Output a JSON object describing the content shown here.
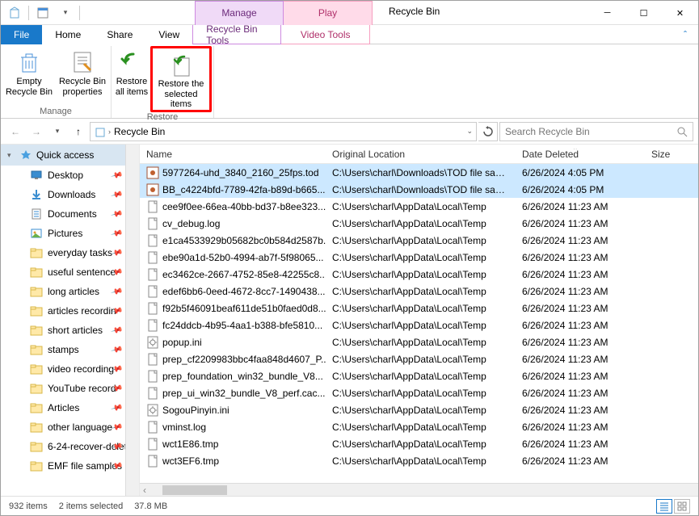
{
  "title": "Recycle Bin",
  "context_tabs": {
    "manage": "Manage",
    "play": "Play"
  },
  "tabs": {
    "file": "File",
    "home": "Home",
    "share": "Share",
    "view": "View",
    "rbt": "Recycle Bin Tools",
    "vt": "Video Tools"
  },
  "ribbon": {
    "manage_group": "Manage",
    "restore_group": "Restore",
    "empty": "Empty Recycle Bin",
    "props": "Recycle Bin properties",
    "restore_all": "Restore all items",
    "restore_sel": "Restore the selected items"
  },
  "breadcrumb": {
    "root": "Recycle Bin"
  },
  "search": {
    "placeholder": "Search Recycle Bin"
  },
  "columns": {
    "name": "Name",
    "loc": "Original Location",
    "date": "Date Deleted",
    "size": "Size"
  },
  "nav": {
    "quick": "Quick access",
    "items": [
      "Desktop",
      "Downloads",
      "Documents",
      "Pictures",
      "everyday tasks",
      "useful sentence",
      "long articles",
      "articles recordin",
      "short articles",
      "stamps",
      "video recording",
      "YouTube record",
      "Articles",
      "other language",
      "6-24-recover-delet",
      "EMF file samples"
    ]
  },
  "files": [
    {
      "name": "5977264-uhd_3840_2160_25fps.tod",
      "loc": "C:\\Users\\charl\\Downloads\\TOD file samp...",
      "date": "6/26/2024 4:05 PM",
      "sel": true,
      "icon": "video"
    },
    {
      "name": "BB_c4224bfd-7789-42fa-b89d-b665...",
      "loc": "C:\\Users\\charl\\Downloads\\TOD file samp...",
      "date": "6/26/2024 4:05 PM",
      "sel": true,
      "icon": "video"
    },
    {
      "name": "cee9f0ee-66ea-40bb-bd37-b8ee323...",
      "loc": "C:\\Users\\charl\\AppData\\Local\\Temp",
      "date": "6/26/2024 11:23 AM",
      "icon": "file"
    },
    {
      "name": "cv_debug.log",
      "loc": "C:\\Users\\charl\\AppData\\Local\\Temp",
      "date": "6/26/2024 11:23 AM",
      "icon": "file"
    },
    {
      "name": "e1ca4533929b05682bc0b584d2587b...",
      "loc": "C:\\Users\\charl\\AppData\\Local\\Temp",
      "date": "6/26/2024 11:23 AM",
      "icon": "file"
    },
    {
      "name": "ebe90a1d-52b0-4994-ab7f-5f98065...",
      "loc": "C:\\Users\\charl\\AppData\\Local\\Temp",
      "date": "6/26/2024 11:23 AM",
      "icon": "file"
    },
    {
      "name": "ec3462ce-2667-4752-85e8-42255c8...",
      "loc": "C:\\Users\\charl\\AppData\\Local\\Temp",
      "date": "6/26/2024 11:23 AM",
      "icon": "file"
    },
    {
      "name": "edef6bb6-0eed-4672-8cc7-1490438...",
      "loc": "C:\\Users\\charl\\AppData\\Local\\Temp",
      "date": "6/26/2024 11:23 AM",
      "icon": "file"
    },
    {
      "name": "f92b5f46091beaf611de51b0faed0d8...",
      "loc": "C:\\Users\\charl\\AppData\\Local\\Temp",
      "date": "6/26/2024 11:23 AM",
      "icon": "file"
    },
    {
      "name": "fc24ddcb-4b95-4aa1-b388-bfe5810...",
      "loc": "C:\\Users\\charl\\AppData\\Local\\Temp",
      "date": "6/26/2024 11:23 AM",
      "icon": "file"
    },
    {
      "name": "popup.ini",
      "loc": "C:\\Users\\charl\\AppData\\Local\\Temp",
      "date": "6/26/2024 11:23 AM",
      "icon": "ini"
    },
    {
      "name": "prep_cf2209983bbc4faa848d4607_P...",
      "loc": "C:\\Users\\charl\\AppData\\Local\\Temp",
      "date": "6/26/2024 11:23 AM",
      "icon": "file"
    },
    {
      "name": "prep_foundation_win32_bundle_V8...",
      "loc": "C:\\Users\\charl\\AppData\\Local\\Temp",
      "date": "6/26/2024 11:23 AM",
      "icon": "file"
    },
    {
      "name": "prep_ui_win32_bundle_V8_perf.cac...",
      "loc": "C:\\Users\\charl\\AppData\\Local\\Temp",
      "date": "6/26/2024 11:23 AM",
      "icon": "file"
    },
    {
      "name": "SogouPinyin.ini",
      "loc": "C:\\Users\\charl\\AppData\\Local\\Temp",
      "date": "6/26/2024 11:23 AM",
      "icon": "ini"
    },
    {
      "name": "vminst.log",
      "loc": "C:\\Users\\charl\\AppData\\Local\\Temp",
      "date": "6/26/2024 11:23 AM",
      "icon": "file"
    },
    {
      "name": "wct1E86.tmp",
      "loc": "C:\\Users\\charl\\AppData\\Local\\Temp",
      "date": "6/26/2024 11:23 AM",
      "icon": "file"
    },
    {
      "name": "wct3EF6.tmp",
      "loc": "C:\\Users\\charl\\AppData\\Local\\Temp",
      "date": "6/26/2024 11:23 AM",
      "icon": "file"
    }
  ],
  "status": {
    "count": "932 items",
    "sel": "2 items selected",
    "size": "37.8 MB"
  }
}
